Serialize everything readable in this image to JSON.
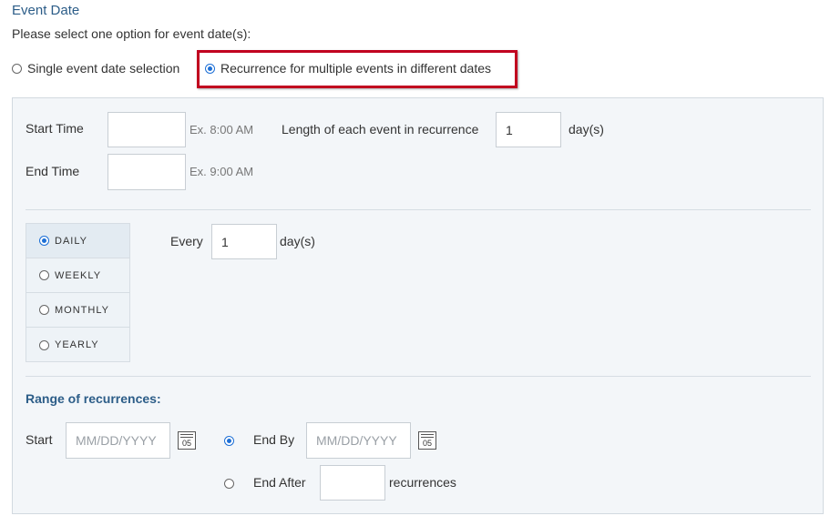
{
  "section": {
    "title": "Event Date",
    "instruction": "Please select one option for event date(s):"
  },
  "date_options": [
    {
      "label": "Single event date selection",
      "selected": false
    },
    {
      "label": "Recurrence for multiple events in different dates",
      "selected": true
    }
  ],
  "time": {
    "start_label": "Start Time",
    "start_value": "",
    "start_hint": "Ex. 8:00 AM",
    "end_label": "End Time",
    "end_value": "",
    "end_hint": "Ex. 9:00 AM",
    "length_label": "Length of each event in recurrence",
    "length_value": "1",
    "length_unit": "day(s)"
  },
  "frequency": {
    "options": [
      {
        "label": "DAILY",
        "selected": true
      },
      {
        "label": "WEEKLY",
        "selected": false
      },
      {
        "label": "MONTHLY",
        "selected": false
      },
      {
        "label": "YEARLY",
        "selected": false
      }
    ],
    "every_label": "Every",
    "every_value": "1",
    "every_unit": "day(s)"
  },
  "range": {
    "title": "Range of recurrences:",
    "start_label": "Start",
    "start_placeholder": "MM/DD/YYYY",
    "calendar_day": "05",
    "end_by_label": "End By",
    "end_by_placeholder": "MM/DD/YYYY",
    "end_by_selected": true,
    "end_after_label": "End After",
    "end_after_value": "",
    "end_after_unit": "recurrences",
    "end_after_selected": false
  },
  "colors": {
    "accent": "#2c5d88",
    "radio_selected": "#1d6fd6",
    "highlight_border": "#c1001f",
    "panel_bg": "#f3f6f9"
  }
}
